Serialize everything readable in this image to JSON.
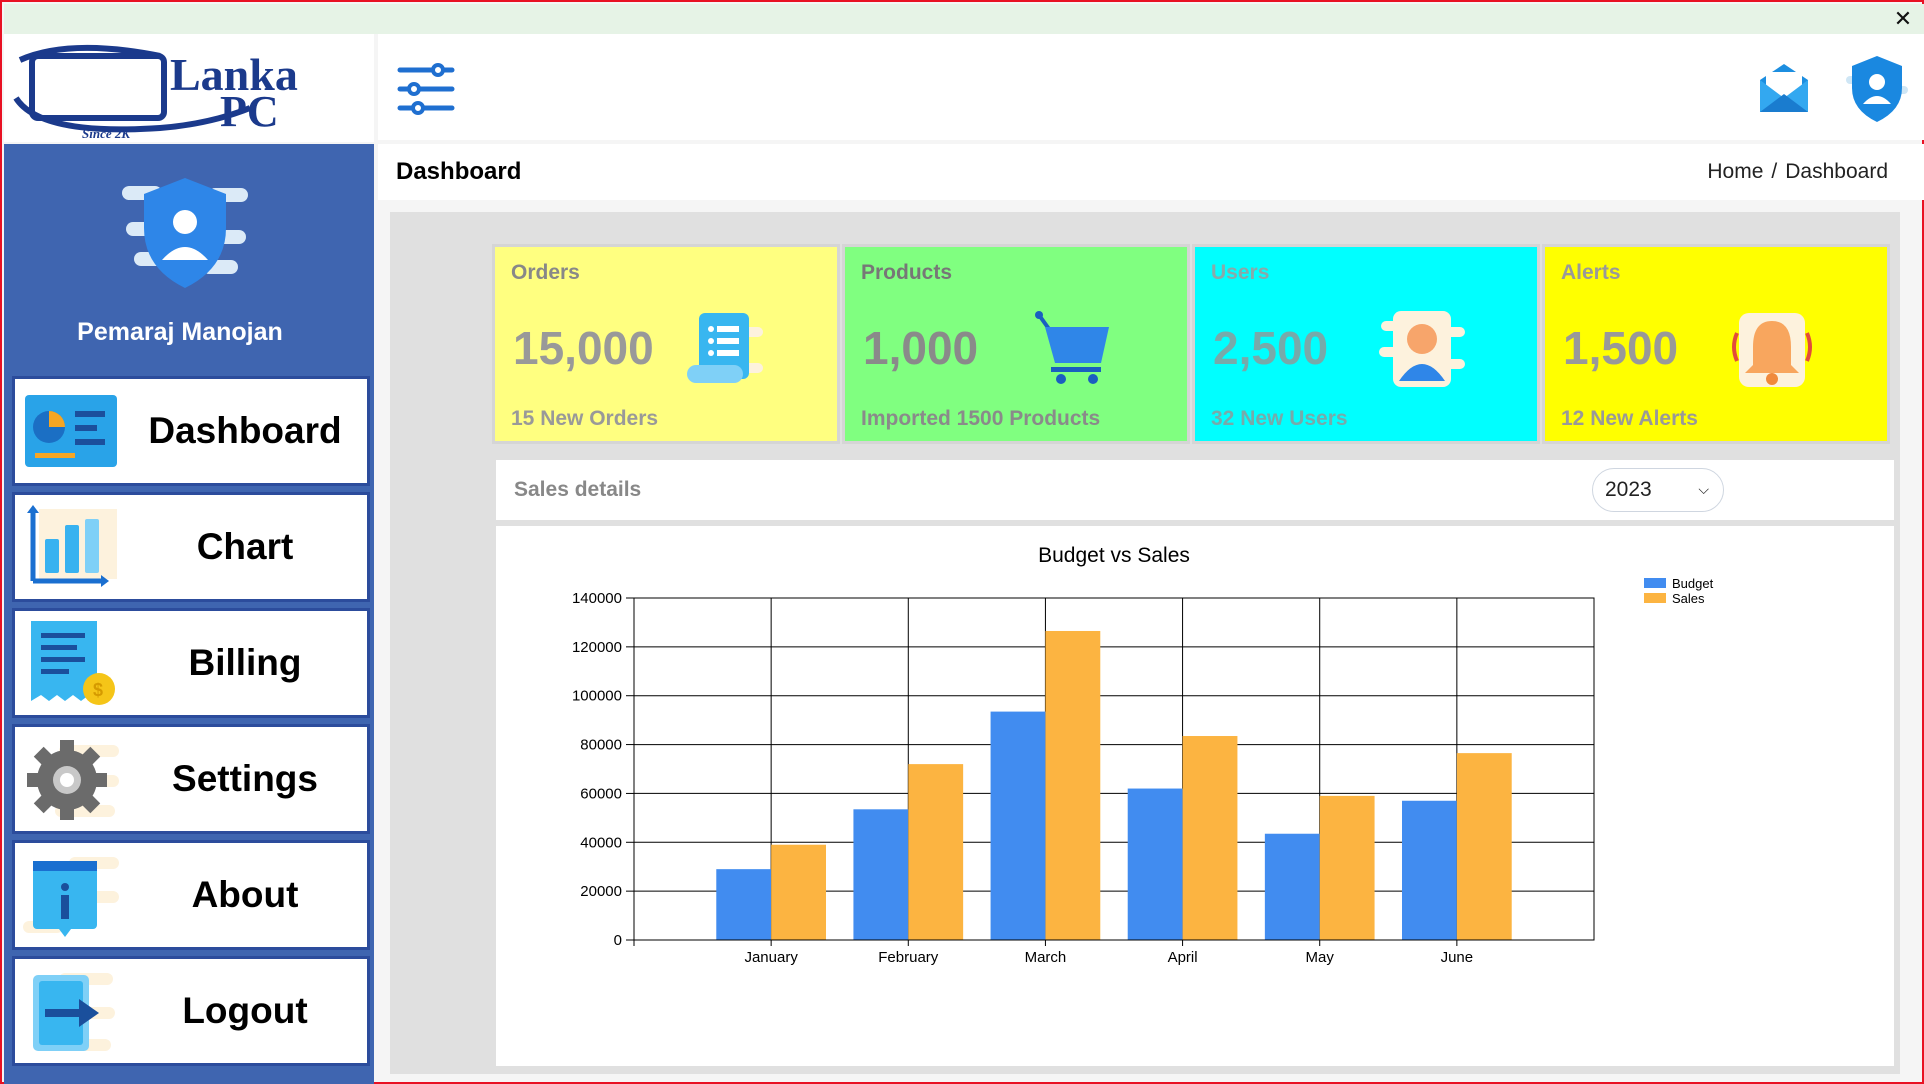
{
  "window": {
    "close_symbol": "✕"
  },
  "logo": {
    "brand_text_1": "Lanka",
    "brand_text_2": "PC",
    "tagline": "Since 2K"
  },
  "topbar": {
    "menu_icon": "sliders-menu-icon",
    "mail_icon": "mail-icon",
    "user_shield_icon": "user-shield-icon"
  },
  "sidebar": {
    "profile_name": "Pemaraj Manojan",
    "items": [
      {
        "label": "Dashboard",
        "icon": "dashboard-icon"
      },
      {
        "label": "Chart",
        "icon": "chart-icon"
      },
      {
        "label": "Billing",
        "icon": "billing-icon"
      },
      {
        "label": "Settings",
        "icon": "gear-icon"
      },
      {
        "label": "About",
        "icon": "info-icon"
      },
      {
        "label": "Logout",
        "icon": "logout-icon"
      }
    ]
  },
  "header": {
    "title": "Dashboard",
    "breadcrumb": [
      "Home",
      "/",
      "Dashboard"
    ]
  },
  "cards": [
    {
      "title": "Orders",
      "value": "15,000",
      "sub": "15 New Orders",
      "icon": "receipt-icon",
      "bg": "#ffff80"
    },
    {
      "title": "Products",
      "value": "1,000",
      "sub": "Imported 1500 Products",
      "icon": "cart-icon",
      "bg": "#80ff80"
    },
    {
      "title": "Users",
      "value": "2,500",
      "sub": "32 New Users",
      "icon": "user-icon",
      "bg": "#00ffff"
    },
    {
      "title": "Alerts",
      "value": "1,500",
      "sub": "12 New Alerts",
      "icon": "bell-icon",
      "bg": "#ffff00"
    }
  ],
  "sales": {
    "label": "Sales details",
    "year": "2023"
  },
  "chart_data": {
    "type": "bar",
    "title": "Budget vs Sales",
    "categories": [
      "January",
      "February",
      "March",
      "April",
      "May",
      "June"
    ],
    "series": [
      {
        "name": "Budget",
        "values": [
          29000,
          53500,
          93500,
          62000,
          43500,
          57000
        ],
        "color": "#418cf0"
      },
      {
        "name": "Sales",
        "values": [
          39000,
          72000,
          126500,
          83500,
          59000,
          76500
        ],
        "color": "#fcb441"
      }
    ],
    "ylim": [
      0,
      140000
    ],
    "yticks": [
      "0",
      "20000",
      "40000",
      "60000",
      "80000",
      "100000",
      "120000",
      "140000"
    ],
    "grid": true,
    "legend": "top-right"
  }
}
